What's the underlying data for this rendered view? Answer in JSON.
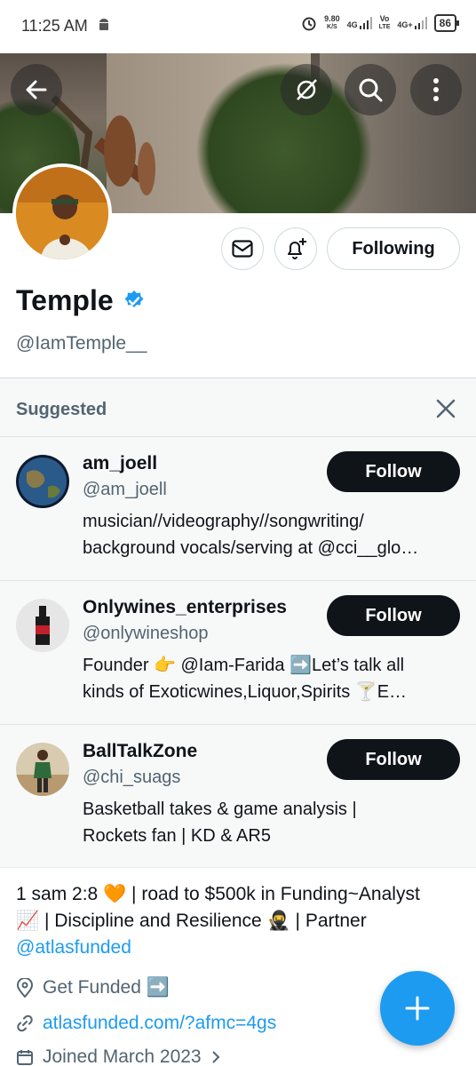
{
  "status_bar": {
    "time": "11:25 AM",
    "speed_value": "9.80",
    "speed_unit": "K/S",
    "network_1": "4G",
    "volte_top": "Vo",
    "volte_bottom": "LTE",
    "network_2": "4G+",
    "battery": "86"
  },
  "profile": {
    "name": "Temple",
    "handle": "@IamTemple__",
    "following_label": "Following",
    "verified": true
  },
  "suggested": {
    "title": "Suggested",
    "items": [
      {
        "name": "am_joell",
        "handle": "@am_joell",
        "bio_line1": "musician//videography//songwriting/",
        "bio_line2": "background vocals/serving at @cci__glo…",
        "follow_label": "Follow"
      },
      {
        "name": "Onlywines_enterprises",
        "handle": "@onlywineshop",
        "bio_line1": "Founder 👉 @Iam-Farida ➡️Let’s talk all",
        "bio_line2": "kinds of Exoticwines,Liquor,Spirits 🍸E…",
        "follow_label": "Follow"
      },
      {
        "name": "BallTalkZone",
        "handle": "@chi_suags",
        "bio_line1": "Basketball takes & game analysis |",
        "bio_line2": "Rockets fan | KD & AR5",
        "follow_label": "Follow"
      }
    ]
  },
  "bio": {
    "line1": "1 sam 2:8 🧡 | road to $500k in Funding~Analyst",
    "line2": "📈 | Discipline and Resilience 🥷 | Partner",
    "mention": "@atlasfunded"
  },
  "meta": {
    "location": "Get Funded ➡️",
    "website": "atlasfunded.com/?afmc=4gs",
    "joined": "Joined March 2023"
  },
  "colors": {
    "accent": "#1d9bf0",
    "text": "#0f1419",
    "secondary": "#536471",
    "follow_bg": "#0f1419"
  }
}
